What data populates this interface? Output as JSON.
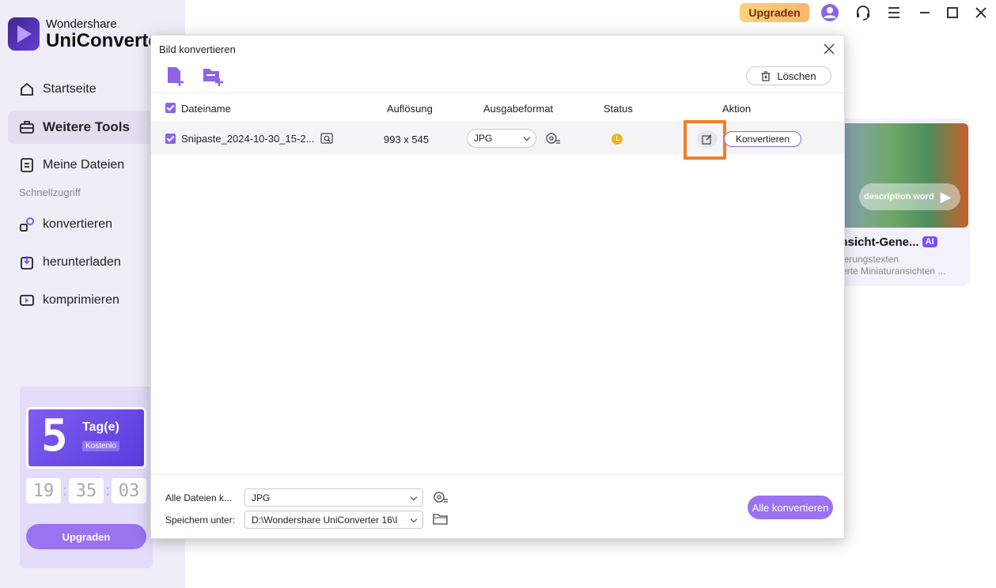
{
  "app": {
    "brand_top": "Wondershare",
    "brand_main": "UniConverter"
  },
  "sidebar": {
    "items": [
      {
        "label": "Startseite",
        "icon": "home-icon"
      },
      {
        "label": "Weitere Tools",
        "icon": "toolbox-icon",
        "active": true
      },
      {
        "label": "Meine Dateien",
        "icon": "files-icon"
      }
    ],
    "section_label": "Schnellzugriff",
    "quick": [
      {
        "label": "konvertieren",
        "icon": "convert-icon"
      },
      {
        "label": "herunterladen",
        "icon": "download-icon"
      },
      {
        "label": "komprimieren",
        "icon": "compress-icon"
      }
    ]
  },
  "promo": {
    "days": "5",
    "days_label": "Tag(e)",
    "free_label": "Kostenlo",
    "timer": [
      "19",
      "35",
      "03"
    ],
    "button": "Upgraden"
  },
  "topbar": {
    "upgrade": "Upgraden"
  },
  "background_card": {
    "pill_text": "description word",
    "title": "ansicht-Gene...",
    "ai_badge": "AI",
    "line1": "lerungstexten",
    "line2": "erte Miniaturansichten ..."
  },
  "modal": {
    "title": "Bild konvertieren",
    "clear": "Löschen",
    "columns": {
      "filename": "Dateiname",
      "resolution": "Auflösung",
      "format": "Ausgabeformat",
      "status": "Status",
      "action": "Aktion"
    },
    "rows": [
      {
        "filename": "Snipaste_2024-10-30_15-2...",
        "resolution": "993 x 545",
        "format": "JPG",
        "convert": "Konvertieren"
      }
    ],
    "footer": {
      "all_files_label": "Alle Dateien k...",
      "all_files_format": "JPG",
      "save_label": "Speichern unter:",
      "save_path": "D:\\Wondershare UniConverter 16\\I",
      "convert_all": "Alle konvertieren"
    }
  },
  "colors": {
    "accent": "#8e63e6",
    "highlight": "#f27d22",
    "sidebar_bg": "#efedf7"
  }
}
